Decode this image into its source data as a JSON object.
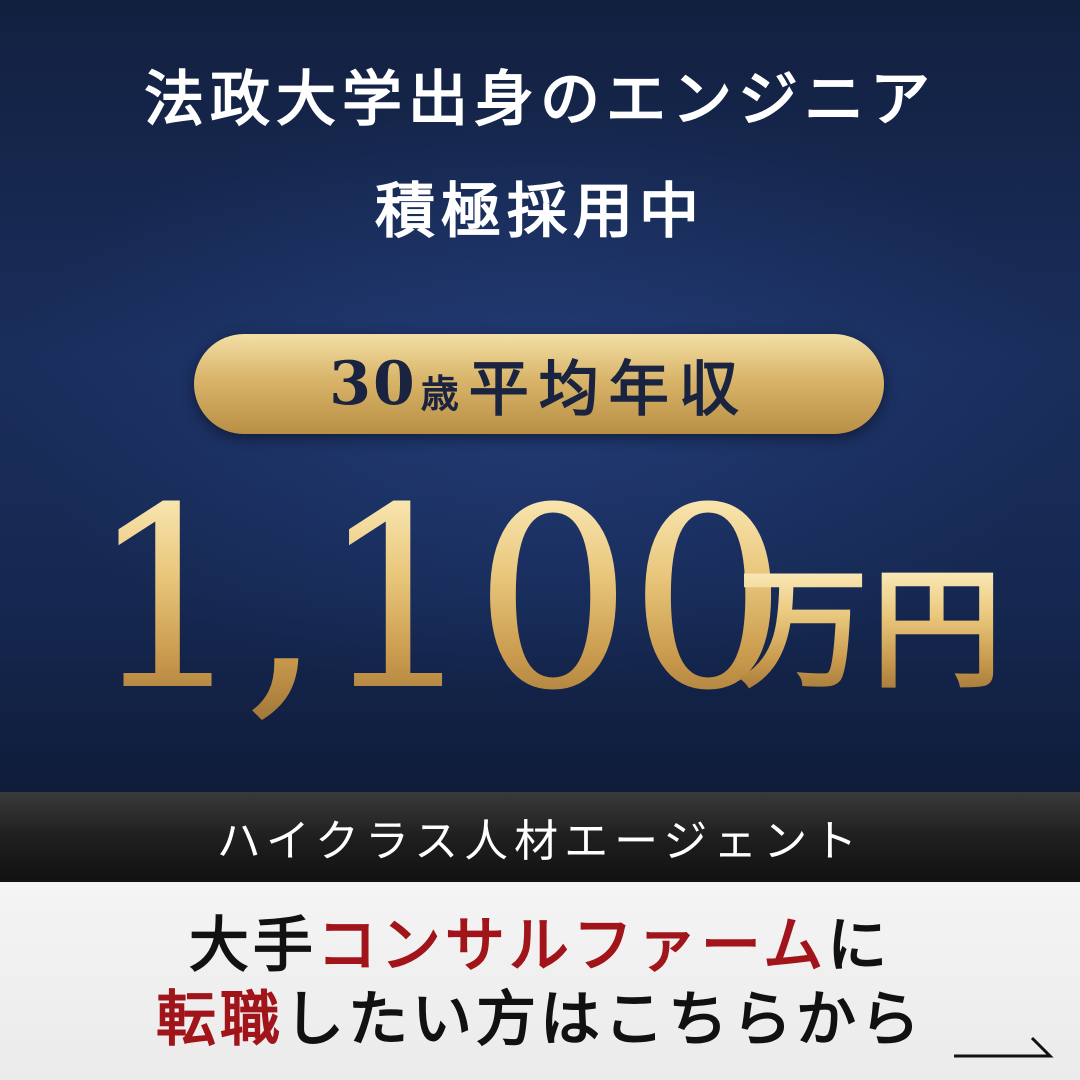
{
  "headline": {
    "line1": "法政大学出身のエンジニア",
    "line2": "積極採用中"
  },
  "badge": {
    "number": "30",
    "age_unit": "歳",
    "label": "平均年収"
  },
  "salary": {
    "amount": "1,100",
    "unit": "万円"
  },
  "band": {
    "text": "ハイクラス人材エージェント"
  },
  "cta": {
    "line1_prefix": "大手",
    "line1_highlight": "コンサルファーム",
    "line1_suffix": "に",
    "line2_highlight": "転職",
    "line2_suffix": "したい方はこちらから"
  },
  "colors": {
    "navy": "#1a2e5c",
    "gold": "#d9b56a",
    "accent_red": "#a0141a",
    "band_dark": "#1f1f1f"
  },
  "icons": {
    "arrow": "arrow-right-icon"
  }
}
